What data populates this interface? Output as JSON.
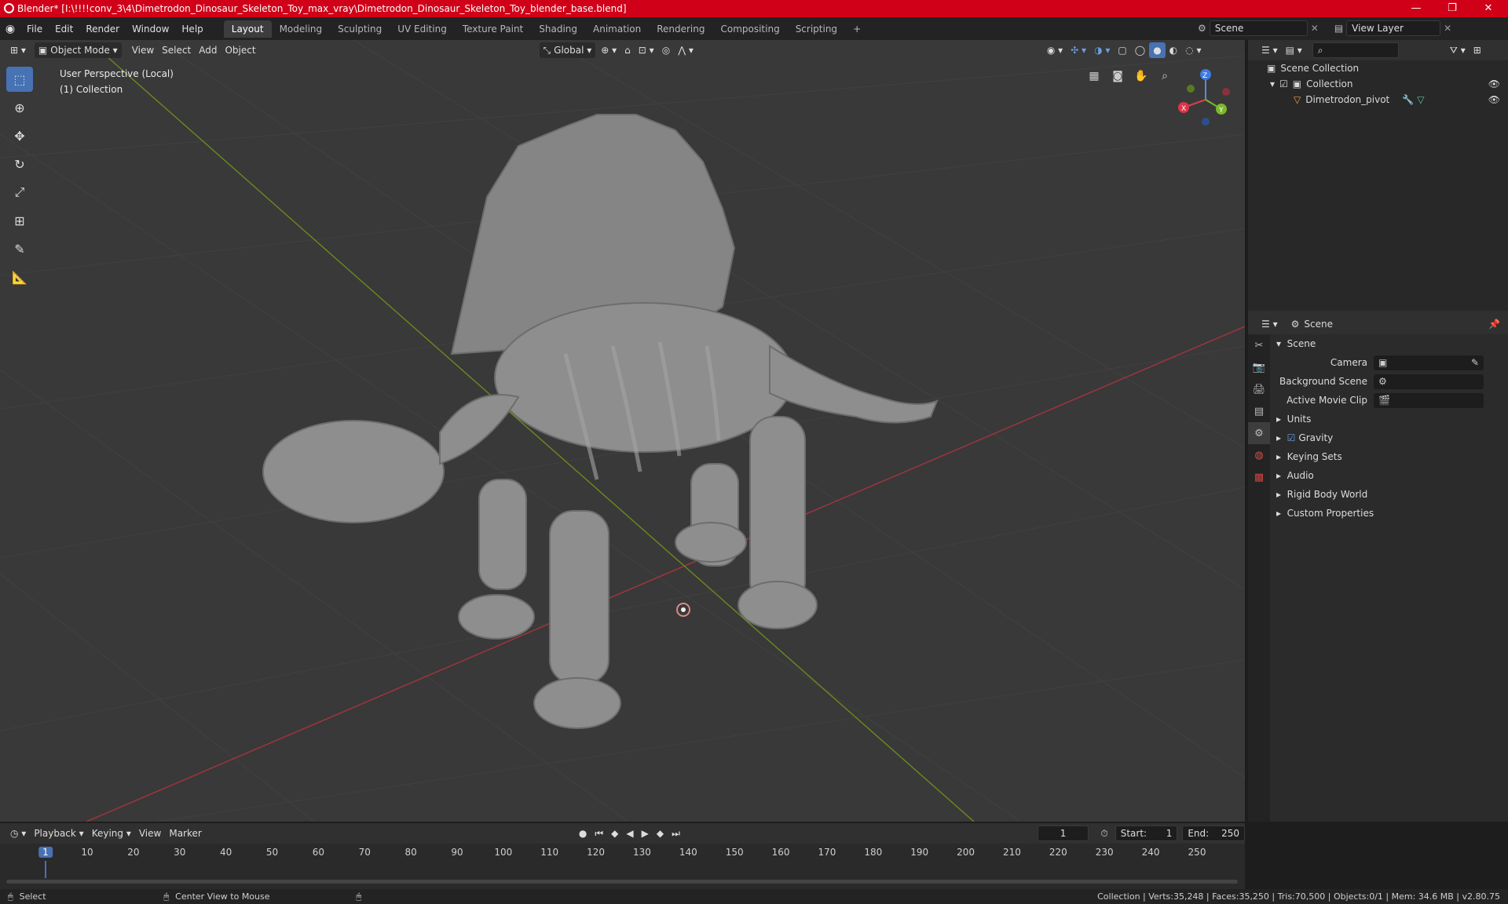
{
  "window": {
    "title": "Blender* [I:\\!!!!conv_3\\4\\Dimetrodon_Dinosaur_Skeleton_Toy_max_vray\\Dimetrodon_Dinosaur_Skeleton_Toy_blender_base.blend]",
    "minimize": "—",
    "maximize": "❐",
    "close": "✕",
    "accent": "#d00018"
  },
  "menu": {
    "items": [
      "File",
      "Edit",
      "Render",
      "Window",
      "Help"
    ],
    "workspaces": [
      "Layout",
      "Modeling",
      "Sculpting",
      "UV Editing",
      "Texture Paint",
      "Shading",
      "Animation",
      "Rendering",
      "Compositing",
      "Scripting"
    ],
    "active_workspace": "Layout",
    "add_tab": "+",
    "scene": "Scene",
    "view_layer": "View Layer"
  },
  "viewport": {
    "mode": "Object Mode",
    "menus": [
      "View",
      "Select",
      "Add",
      "Object"
    ],
    "transform_orientation": "Global",
    "info_line1": "User Perspective (Local)",
    "info_line2": "(1) Collection",
    "background": "#393939",
    "gizmo_axes": [
      "X",
      "Y",
      "Z"
    ]
  },
  "outliner": {
    "search_placeholder": "",
    "root": "Scene Collection",
    "collection": "Collection",
    "object": "Dimetrodon_pivot"
  },
  "properties": {
    "header": "Scene",
    "section": "Scene",
    "camera_label": "Camera",
    "background_scene_label": "Background Scene",
    "active_movie_clip_label": "Active Movie Clip",
    "panels": [
      "Units",
      "Gravity",
      "Keying Sets",
      "Audio",
      "Rigid Body World",
      "Custom Properties"
    ],
    "gravity_checked": true
  },
  "timeline": {
    "menus": [
      "Playback",
      "Keying",
      "View",
      "Marker"
    ],
    "current_frame": "1",
    "start_label": "Start:",
    "start": "1",
    "end_label": "End:",
    "end": "250",
    "ruler_ticks": [
      "1",
      "10",
      "20",
      "30",
      "40",
      "50",
      "60",
      "70",
      "80",
      "90",
      "100",
      "110",
      "120",
      "130",
      "140",
      "150",
      "160",
      "170",
      "180",
      "190",
      "200",
      "210",
      "220",
      "230",
      "240",
      "250"
    ]
  },
  "status": {
    "left": "Select",
    "middle": "Center View to Mouse",
    "right": "Collection | Verts:35,248 | Faces:35,250 | Tris:70,500 | Objects:0/1 | Mem: 34.6 MB | v2.80.75"
  }
}
